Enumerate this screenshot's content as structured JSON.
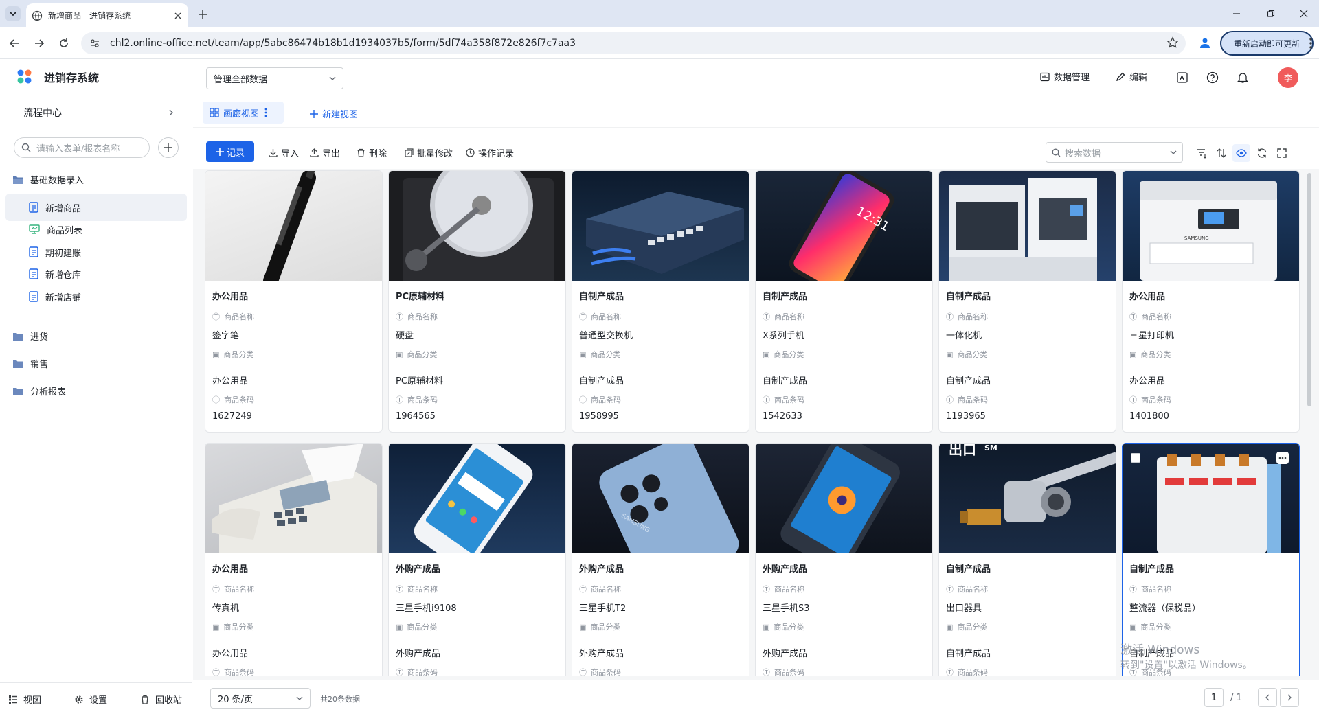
{
  "browser": {
    "tab_title": "新增商品 - 进销存系统",
    "url": "chl2.online-office.net/team/app/5abc86474b18b1d1934037b5/form/5df74a358f872e826f7c7aa3",
    "update_label": "重新启动即可更新"
  },
  "app": {
    "name": "进销存系统",
    "flow_center": "流程中心",
    "search_placeholder": "请输入表单/报表名称",
    "groups": {
      "basic": "基础数据录入",
      "purchase": "进货",
      "sales": "销售",
      "reports": "分析报表"
    },
    "items": [
      "新增商品",
      "商品列表",
      "期初建账",
      "新增仓库",
      "新增店铺"
    ],
    "footer": {
      "view": "视图",
      "settings": "设置",
      "recycle": "回收站"
    }
  },
  "header": {
    "data_scope": "管理全部数据",
    "data_manage": "数据管理",
    "edit": "编辑",
    "avatar_text": "李"
  },
  "views": {
    "gallery": "画廊视图",
    "new_view": "新建视图"
  },
  "toolbar": {
    "add": "记录",
    "import": "导入",
    "export": "导出",
    "delete": "删除",
    "batch_edit": "批量修改",
    "log": "操作记录",
    "search_placeholder": "搜索数据"
  },
  "fields": {
    "name": "商品名称",
    "category": "商品分类",
    "barcode": "商品条码"
  },
  "cards": [
    {
      "cat": "办公用品",
      "name": "签字笔",
      "category": "办公用品",
      "barcode": "1627249",
      "icon": "pen-image"
    },
    {
      "cat": "PC原辅材料",
      "name": "硬盘",
      "category": "PC原辅材料",
      "barcode": "1964565",
      "icon": "hard-disk-image"
    },
    {
      "cat": "自制产成品",
      "name": "普通型交换机",
      "category": "自制产成品",
      "barcode": "1958995",
      "icon": "switch-image"
    },
    {
      "cat": "自制产成品",
      "name": "X系列手机",
      "category": "自制产成品",
      "barcode": "1542633",
      "icon": "phone-image"
    },
    {
      "cat": "自制产成品",
      "name": "一体化机",
      "category": "自制产成品",
      "barcode": "1193965",
      "icon": "machine-image"
    },
    {
      "cat": "办公用品",
      "name": "三星打印机",
      "category": "办公用品",
      "barcode": "1401800",
      "icon": "printer-image"
    },
    {
      "cat": "办公用品",
      "name": "传真机",
      "category": "办公用品",
      "barcode": "",
      "icon": "fax-image"
    },
    {
      "cat": "外购产成品",
      "name": "三星手机i9108",
      "category": "外购产成品",
      "barcode": "",
      "icon": "phone-image"
    },
    {
      "cat": "外购产成品",
      "name": "三星手机T2",
      "category": "外购产成品",
      "barcode": "",
      "icon": "phone-back-image"
    },
    {
      "cat": "外购产成品",
      "name": "三星手机S3",
      "category": "外购产成品",
      "barcode": "",
      "icon": "phone-image"
    },
    {
      "cat": "自制产成品",
      "name": "出口器具",
      "category": "自制产成品",
      "barcode": "",
      "icon": "valve-image"
    },
    {
      "cat": "自制产成品",
      "name": "整流器（保税品）",
      "category": "自制产成品",
      "barcode": "",
      "icon": "breaker-image"
    }
  ],
  "image_text": {
    "valve_title": "出口",
    "valve_sm": "SM",
    "samsung": "SAMSUNG",
    "phone_time": "12:31"
  },
  "pagination": {
    "page_size": "20 条/页",
    "total": "共20条数据",
    "current": "1",
    "total_pages": "/ 1"
  },
  "watermark": {
    "line1": "激活 Windows",
    "line2": "转到\"设置\"以激活 Windows。"
  },
  "colors": {
    "primary": "#1d63e7",
    "avatar": "#f05b5b"
  }
}
